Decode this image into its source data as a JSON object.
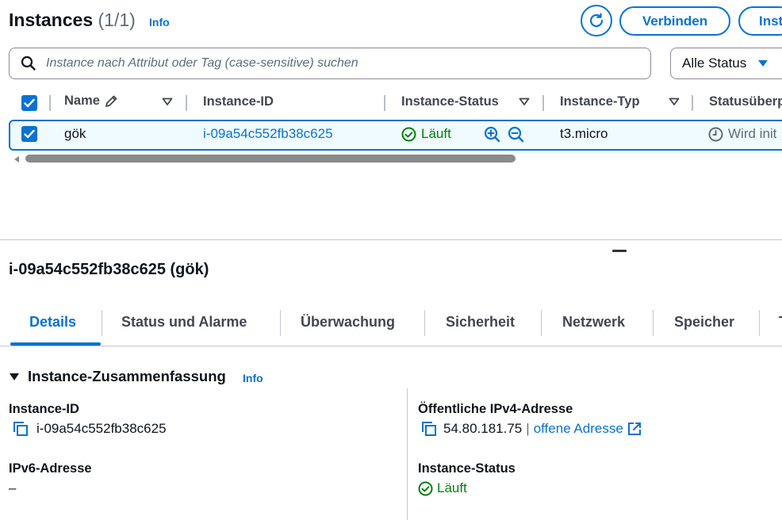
{
  "header": {
    "title": "Instances",
    "count": "(1/1)",
    "info": "Info",
    "connect_label": "Verbinden",
    "launch_label_partial": "Inst"
  },
  "search": {
    "placeholder": "Instance nach Attribut oder Tag (case-sensitive) suchen",
    "value": ""
  },
  "status_filter": {
    "selected": "Alle Status"
  },
  "table": {
    "columns": [
      {
        "label": "Name"
      },
      {
        "label": "Instance-ID"
      },
      {
        "label": "Instance-Status"
      },
      {
        "label": "Instance-Typ"
      },
      {
        "label": "Statusüberp"
      }
    ],
    "rows": [
      {
        "name": "gök",
        "instance_id": "i-09a54c552fb38c625",
        "instance_state": "Läuft",
        "instance_type": "t3.micro",
        "status_check": "Wird init"
      }
    ]
  },
  "details": {
    "title": "i-09a54c552fb38c625 (gök)",
    "tabs": [
      {
        "label": "Details"
      },
      {
        "label": "Status und Alarme"
      },
      {
        "label": "Überwachung"
      },
      {
        "label": "Sicherheit"
      },
      {
        "label": "Netzwerk"
      },
      {
        "label": "Speicher"
      },
      {
        "label": "T"
      }
    ],
    "section_title": "Instance-Zusammenfassung",
    "section_info": "Info",
    "fields": {
      "instance_id_label": "Instance-ID",
      "instance_id_value": "i-09a54c552fb38c625",
      "public_ipv4_label": "Öffentliche IPv4-Adresse",
      "public_ipv4_value": "54.80.181.75",
      "public_ipv4_separator": "|",
      "open_address_label": "offene Adresse",
      "ipv6_label": "IPv6-Adresse",
      "ipv6_value": "–",
      "instance_state_label": "Instance-Status",
      "instance_state_value": "Läuft"
    }
  },
  "colors": {
    "accent": "#0972d3",
    "success": "#037f0c",
    "text": "#0f141a",
    "muted": "#5f6b7a"
  }
}
